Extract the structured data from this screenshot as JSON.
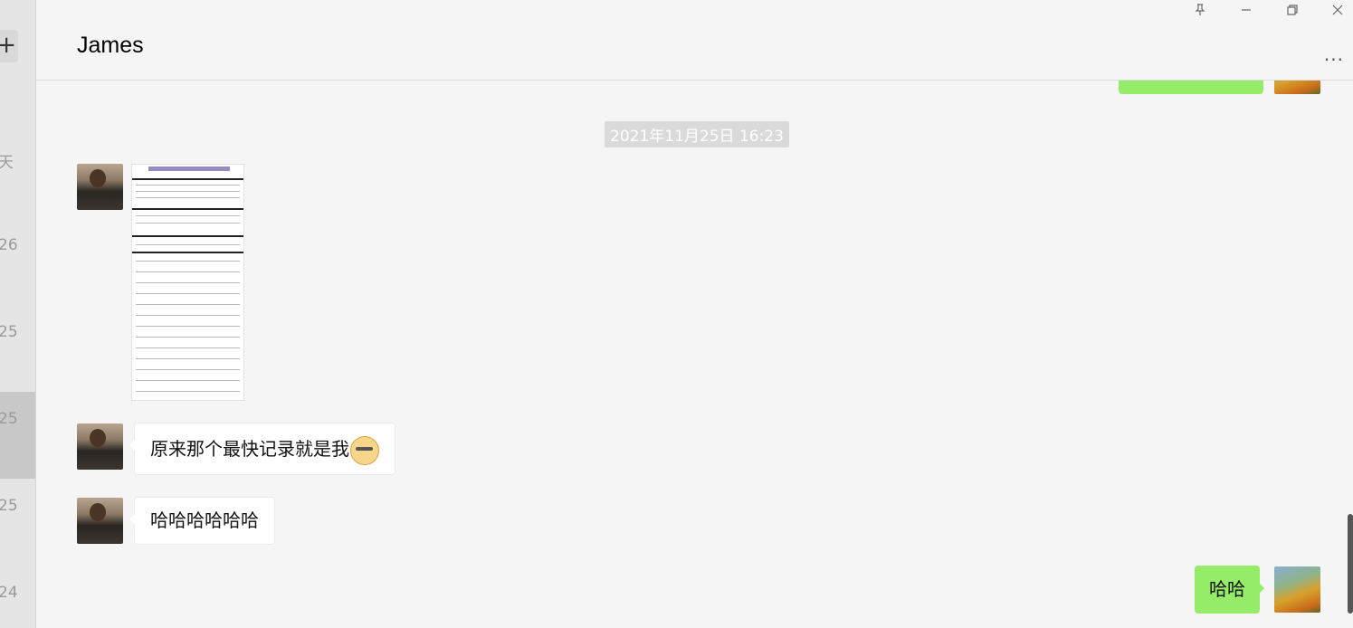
{
  "window": {
    "pin_icon": "pin-icon",
    "minimize_icon": "minimize-icon",
    "restore_icon": "restore-icon",
    "close_icon": "close-icon"
  },
  "sidebar": {
    "add_label": "+",
    "items": [
      {
        "date": "天"
      },
      {
        "date": "26"
      },
      {
        "date": "25"
      },
      {
        "date": "25",
        "active": true
      },
      {
        "date": "25"
      },
      {
        "date": "24"
      }
    ]
  },
  "header": {
    "title": "James",
    "more_label": "..."
  },
  "chat": {
    "timestamp": "2021年11月25日 16:23",
    "messages": [
      {
        "sender": "friend",
        "type": "image"
      },
      {
        "sender": "friend",
        "type": "text",
        "text": "原来那个最快记录就是我",
        "emoji": "cat-face-emoji"
      },
      {
        "sender": "friend",
        "type": "text",
        "text": "哈哈哈哈哈哈"
      },
      {
        "sender": "me",
        "type": "text",
        "text": "哈哈"
      }
    ]
  },
  "colors": {
    "background": "#f5f5f5",
    "my_bubble": "#95ec69",
    "friend_bubble": "#ffffff",
    "timestamp_bg": "#dadada"
  }
}
